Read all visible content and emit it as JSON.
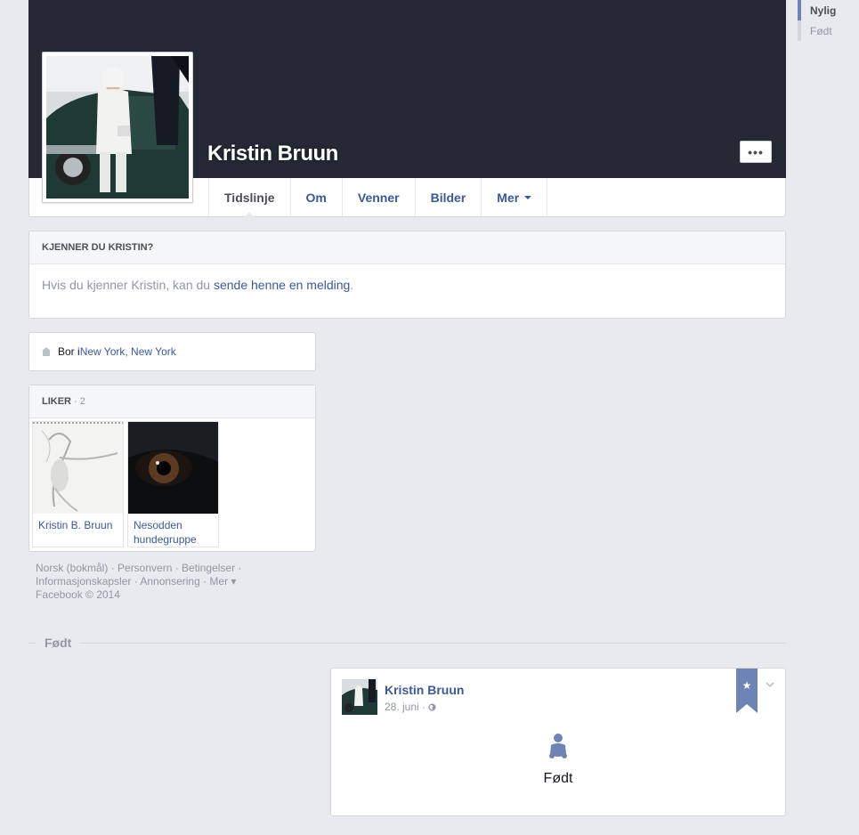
{
  "scrubber": {
    "items": [
      {
        "label": "Nylig"
      },
      {
        "label": "Født"
      }
    ]
  },
  "profile": {
    "name": "Kristin Bruun",
    "more_label": "•••"
  },
  "tabs": [
    {
      "label": "Tidslinje"
    },
    {
      "label": "Om"
    },
    {
      "label": "Venner"
    },
    {
      "label": "Bilder"
    },
    {
      "label": "Mer"
    }
  ],
  "know": {
    "title": "KJENNER DU KRISTIN?",
    "text_before": "Hvis du kjenner Kristin, kan du ",
    "link": "sende henne en melding",
    "text_after": "."
  },
  "lives": {
    "prefix": "Bor i ",
    "place": "New York, New York"
  },
  "likes": {
    "title": "LIKER",
    "count": "· 2",
    "items": [
      {
        "name": "Kristin B. Bruun"
      },
      {
        "name": "Nesodden hundegruppe"
      }
    ]
  },
  "footer": {
    "line1": "Norsk (bokmål) · Personvern · Betingelser ·",
    "line2": "Informasjonskapsler · Annonsering · Mer ▾",
    "line3": "Facebook © 2014"
  },
  "section": {
    "label": "Født"
  },
  "story": {
    "name": "Kristin Bruun",
    "date": "28. juni",
    "privacy_sep": " · ",
    "event": "Født",
    "ribbon_star": "★"
  },
  "colors": {
    "cover": "#252936",
    "brand_link": "#3b5998",
    "ribbon": "#6d84b4",
    "background": "#e9eaed"
  }
}
